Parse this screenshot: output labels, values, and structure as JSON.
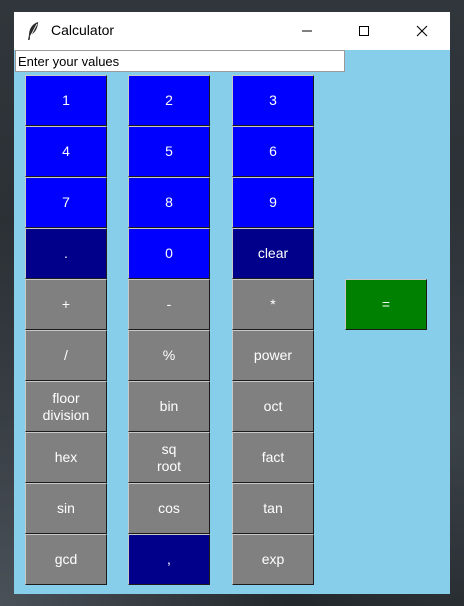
{
  "window": {
    "title": "Calculator",
    "icon": "feather-icon",
    "controls": [
      "minimize-icon",
      "maximize-icon",
      "close-icon"
    ]
  },
  "input": {
    "value": "Enter your values"
  },
  "colors": {
    "background": "#87ceeb",
    "digit": "#0000ff",
    "special": "#00008b",
    "operator": "#808080",
    "equals": "#008000",
    "text": "#ffffff"
  },
  "keys": {
    "k1": "1",
    "k2": "2",
    "k3": "3",
    "k4": "4",
    "k5": "5",
    "k6": "6",
    "k7": "7",
    "k8": "8",
    "k9": "9",
    "dot": ".",
    "k0": "0",
    "clear": "clear",
    "plus": "+",
    "minus": "-",
    "multiply": "*",
    "divide": "/",
    "modulo": "%",
    "power": "power",
    "floor_division": "floor\ndivision",
    "bin": "bin",
    "oct": "oct",
    "hex": "hex",
    "sqroot": "sq\nroot",
    "fact": "fact",
    "sin": "sin",
    "cos": "cos",
    "tan": "tan",
    "gcd": "gcd",
    "comma": ",",
    "exp": "exp",
    "equals": "="
  }
}
